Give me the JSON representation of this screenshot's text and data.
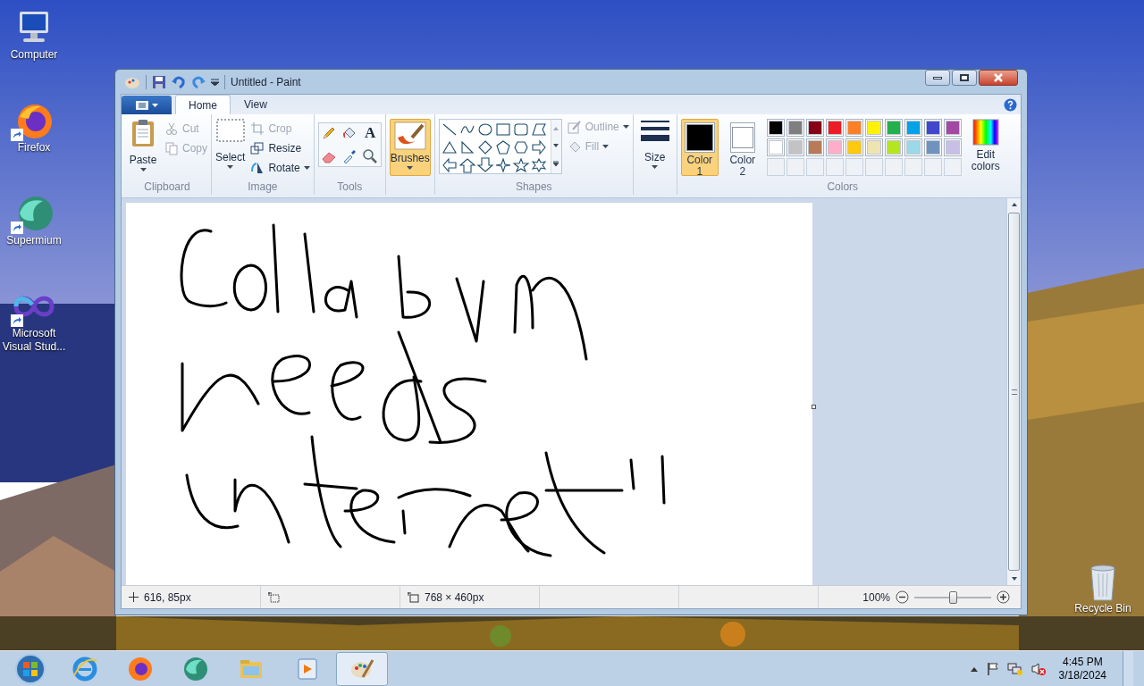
{
  "desktop_icons": [
    {
      "kind": "computer",
      "label": "Computer"
    },
    {
      "kind": "firefox",
      "label": "Firefox"
    },
    {
      "kind": "supermium",
      "label": "Supermium"
    },
    {
      "kind": "vs",
      "label": "Microsoft Visual Stud..."
    }
  ],
  "recycle_bin": {
    "label": "Recycle Bin"
  },
  "window": {
    "title": "Untitled - Paint"
  },
  "tabs": [
    {
      "label": "Home",
      "selected": true
    },
    {
      "label": "View",
      "selected": false
    }
  ],
  "clipboard": {
    "label": "Clipboard",
    "paste": "Paste",
    "items": [
      {
        "kind": "cut",
        "label": "Cut",
        "disabled": true
      },
      {
        "kind": "copy",
        "label": "Copy",
        "disabled": true
      }
    ]
  },
  "image": {
    "label": "Image",
    "select": "Select",
    "items": [
      {
        "kind": "crop",
        "label": "Crop",
        "disabled": true
      },
      {
        "kind": "resize",
        "label": "Resize",
        "disabled": false
      },
      {
        "kind": "rotate",
        "label": "Rotate",
        "disabled": false
      }
    ]
  },
  "tools": {
    "label": "Tools",
    "items": [
      {
        "kind": "pencil"
      },
      {
        "kind": "fill"
      },
      {
        "kind": "text",
        "label": "A"
      },
      {
        "kind": "eraser"
      },
      {
        "kind": "picker"
      },
      {
        "kind": "magnifier"
      }
    ]
  },
  "brushes": {
    "label": "Brushes",
    "selected": true
  },
  "shapes": {
    "label": "Shapes",
    "outline": {
      "label": "Outline",
      "disabled": true
    },
    "fill": {
      "label": "Fill",
      "disabled": true
    }
  },
  "size": {
    "label": "Size"
  },
  "colors": {
    "label": "Colors",
    "color1": {
      "label": "Color 1",
      "color": "#000000",
      "selected": true
    },
    "color2": {
      "label": "Color 2",
      "color": "#ffffff",
      "selected": false
    },
    "palette": [
      {
        "color": "#000000"
      },
      {
        "color": "#7f7f7f"
      },
      {
        "color": "#880015"
      },
      {
        "color": "#ed1c24"
      },
      {
        "color": "#ff7f27"
      },
      {
        "color": "#fff200"
      },
      {
        "color": "#22b14c"
      },
      {
        "color": "#00a2e8"
      },
      {
        "color": "#3f48cc"
      },
      {
        "color": "#a349a4"
      },
      {
        "color": "#ffffff"
      },
      {
        "color": "#c3c3c3"
      },
      {
        "color": "#b97a57"
      },
      {
        "color": "#ffaec9"
      },
      {
        "color": "#ffc90e"
      },
      {
        "color": "#efe4b0"
      },
      {
        "color": "#b5e61d"
      },
      {
        "color": "#99d9ea"
      },
      {
        "color": "#7092be"
      },
      {
        "color": "#c8bfe7"
      }
    ],
    "edit": "Edit colors"
  },
  "status_bar": {
    "cursor": "616, 85px",
    "image_size": "768 × 460px",
    "zoom": "100%",
    "zoom_level": {
      "level": 0.5
    }
  },
  "taskbar": {
    "apps": [
      {
        "kind": "ie",
        "selected": false
      },
      {
        "kind": "firefox",
        "selected": false
      },
      {
        "kind": "supermium",
        "selected": false
      },
      {
        "kind": "explorer",
        "selected": false
      },
      {
        "kind": "media",
        "selected": false
      },
      {
        "kind": "paint",
        "selected": true
      }
    ],
    "time": "4:45 PM",
    "date": "3/18/2024"
  }
}
